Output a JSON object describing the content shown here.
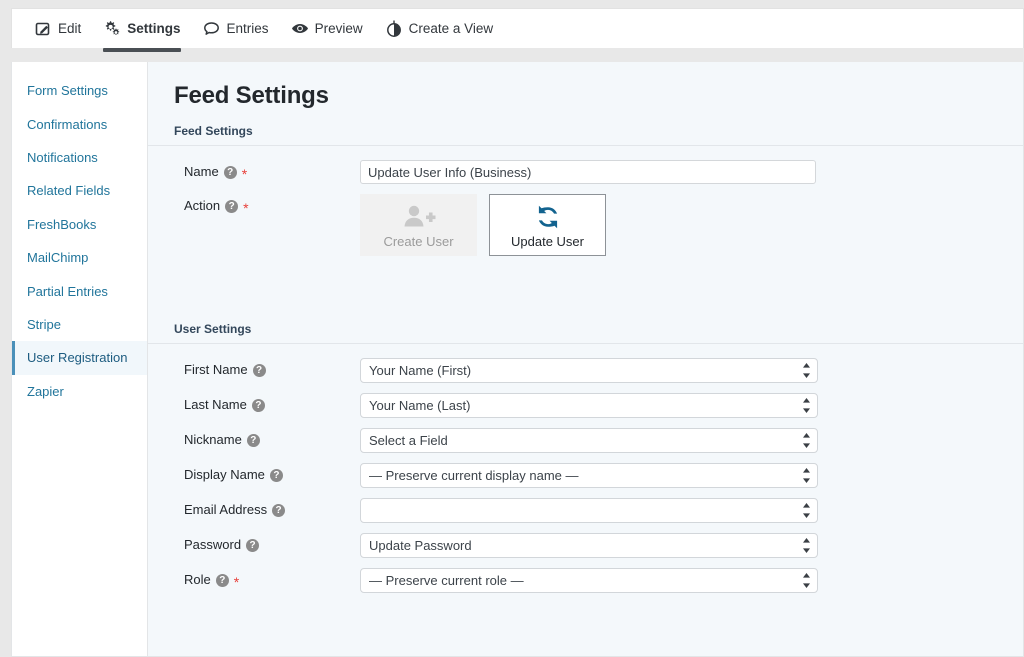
{
  "tabs": [
    {
      "label": "Edit",
      "icon": "pencil-square-icon",
      "active": false
    },
    {
      "label": "Settings",
      "icon": "gears-icon",
      "active": true
    },
    {
      "label": "Entries",
      "icon": "speech-bubble-icon",
      "active": false
    },
    {
      "label": "Preview",
      "icon": "eye-icon",
      "active": false
    },
    {
      "label": "Create a View",
      "icon": "view-globe-icon",
      "active": false
    }
  ],
  "sidebar": {
    "items": [
      {
        "label": "Form Settings"
      },
      {
        "label": "Confirmations"
      },
      {
        "label": "Notifications"
      },
      {
        "label": "Related Fields"
      },
      {
        "label": "FreshBooks"
      },
      {
        "label": "MailChimp"
      },
      {
        "label": "Partial Entries"
      },
      {
        "label": "Stripe"
      },
      {
        "label": "User Registration"
      },
      {
        "label": "Zapier"
      }
    ],
    "active_index": 8
  },
  "main": {
    "page_title": "Feed Settings",
    "feed_section": {
      "label": "Feed Settings",
      "name_field": {
        "label": "Name",
        "help": "?",
        "required": "*",
        "value": "Update User Info (Business)",
        "placeholder": ""
      },
      "action_field": {
        "label": "Action",
        "help": "?",
        "required": "*",
        "buttons": [
          {
            "label": "Create User",
            "icon": "user-plus-icon",
            "state": "inactive"
          },
          {
            "label": "Update User",
            "icon": "sync-refresh-icon",
            "state": "selected"
          }
        ]
      }
    },
    "user_section": {
      "label": "User Settings",
      "fields": [
        {
          "label": "First Name",
          "help": "?",
          "required": "",
          "value": "Your Name (First)"
        },
        {
          "label": "Last Name",
          "help": "?",
          "required": "",
          "value": "Your Name (Last)"
        },
        {
          "label": "Nickname",
          "help": "?",
          "required": "",
          "value": "Select a Field"
        },
        {
          "label": "Display Name",
          "help": "?",
          "required": "",
          "value": "— Preserve current display name —"
        },
        {
          "label": "Email Address",
          "help": "?",
          "required": "",
          "value": ""
        },
        {
          "label": "Password",
          "help": "?",
          "required": "",
          "value": "Update Password"
        },
        {
          "label": "Role",
          "help": "?",
          "required": "*",
          "value": "— Preserve current role —"
        }
      ]
    }
  },
  "colors": {
    "link_blue": "#21759b",
    "accent_blue": "#1b6a9c",
    "required_red": "#e8403a",
    "panel_bg": "#f4f8fb"
  }
}
